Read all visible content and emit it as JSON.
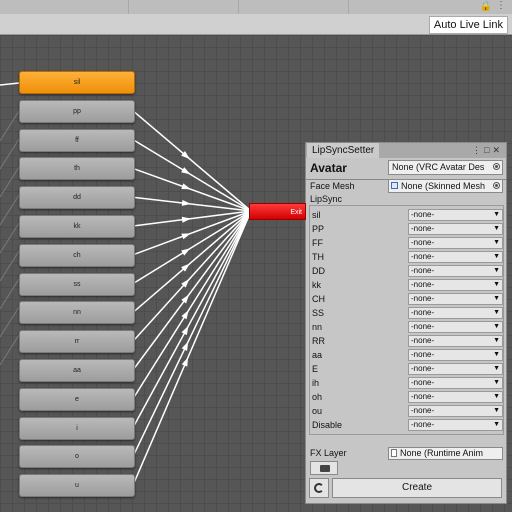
{
  "toolbar": {
    "auto_live_link": "Auto Live Link"
  },
  "graph": {
    "default_state": "sil",
    "states": [
      "pp",
      "ff",
      "th",
      "dd",
      "kk",
      "ch",
      "ss",
      "nn",
      "rr",
      "aa",
      "e",
      "i",
      "o",
      "u"
    ],
    "exit_label": "Exit"
  },
  "panel": {
    "tab_title": "LipSyncSetter",
    "avatar_label": "Avatar",
    "avatar_value": "None (VRC Avatar Des",
    "face_mesh_label": "Face Mesh",
    "face_mesh_value": "None (Skinned Mesh",
    "lipsync_label": "LipSync",
    "rows": [
      {
        "label": "sil",
        "value": "-none-"
      },
      {
        "label": "PP",
        "value": "-none-"
      },
      {
        "label": "FF",
        "value": "-none-"
      },
      {
        "label": "TH",
        "value": "-none-"
      },
      {
        "label": "DD",
        "value": "-none-"
      },
      {
        "label": "kk",
        "value": "-none-"
      },
      {
        "label": "CH",
        "value": "-none-"
      },
      {
        "label": "SS",
        "value": "-none-"
      },
      {
        "label": "nn",
        "value": "-none-"
      },
      {
        "label": "RR",
        "value": "-none-"
      },
      {
        "label": "aa",
        "value": "-none-"
      },
      {
        "label": "E",
        "value": "-none-"
      },
      {
        "label": "ih",
        "value": "-none-"
      },
      {
        "label": "oh",
        "value": "-none-"
      },
      {
        "label": "ou",
        "value": "-none-"
      },
      {
        "label": "Disable",
        "value": "-none-"
      }
    ],
    "fx_layer_label": "FX Layer",
    "fx_layer_value": "None (Runtime Anim",
    "create_label": "Create"
  },
  "icons": {
    "lock": "lock-icon",
    "menu": "menu-icon",
    "folder": "folder-icon",
    "refresh": "refresh-icon"
  }
}
